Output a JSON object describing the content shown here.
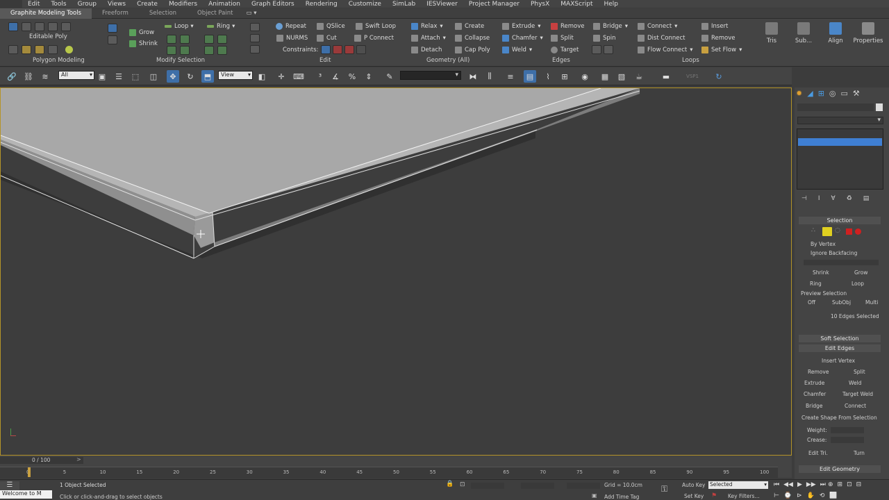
{
  "menu": [
    "Edit",
    "Tools",
    "Group",
    "Views",
    "Create",
    "Modifiers",
    "Animation",
    "Graph Editors",
    "Rendering",
    "Customize",
    "SimLab",
    "IESViewer",
    "Project Manager",
    "PhysX",
    "MAXScript",
    "Help"
  ],
  "ribbon_tabs": [
    "Graphite Modeling Tools",
    "Freeform",
    "Selection",
    "Object Paint"
  ],
  "ribbon": {
    "poly_label": "Editable Poly",
    "grow": "Grow",
    "shrink": "Shrink",
    "loop": "Loop",
    "ring": "Ring",
    "repeat": "Repeat",
    "qslice": "QSlice",
    "swift_loop": "Swift Loop",
    "nurms": "NURMS",
    "cut": "Cut",
    "p_connect": "P Connect",
    "constraints": "Constraints:",
    "relax": "Relax",
    "create": "Create",
    "attach": "Attach",
    "collapse": "Collapse",
    "detach": "Detach",
    "cap_poly": "Cap Poly",
    "extrude": "Extrude",
    "remove": "Remove",
    "bridge": "Bridge",
    "chamfer": "Chamfer",
    "split": "Split",
    "spin": "Spin",
    "weld": "Weld",
    "target": "Target",
    "connect": "Connect",
    "insert": "Insert",
    "dist_connect": "Dist Connect",
    "remove2": "Remove",
    "flow_connect": "Flow Connect",
    "set_flow": "Set Flow",
    "tris": "Tris",
    "sub": "Sub...",
    "align": "Align",
    "properties": "Properties",
    "panels": [
      "Polygon Modeling",
      "Modify Selection",
      "Edit",
      "Geometry (All)",
      "Edges",
      "Loops"
    ]
  },
  "toolbar": {
    "filter": "All",
    "view": "View"
  },
  "command_panel": {
    "selection_title": "Selection",
    "by_vertex": "By Vertex",
    "ignore_backfacing": "Ignore Backfacing",
    "shrink": "Shrink",
    "grow": "Grow",
    "ring": "Ring",
    "loop": "Loop",
    "preview_selection": "Preview Selection",
    "off": "Off",
    "subobj": "SubObj",
    "multi": "Multi",
    "edges_selected": "10 Edges Selected",
    "soft_selection": "Soft Selection",
    "edit_edges": "Edit Edges",
    "insert_vertex": "Insert Vertex",
    "remove": "Remove",
    "split": "Split",
    "extrude": "Extrude",
    "weld": "Weld",
    "chamfer": "Chamfer",
    "target_weld": "Target Weld",
    "bridge": "Bridge",
    "connect": "Connect",
    "create_shape": "Create Shape From Selection",
    "weight": "Weight:",
    "crease": "Crease:",
    "edit_tri": "Edit Tri.",
    "turn": "Turn",
    "edit_geometry": "Edit Geometry"
  },
  "timeline": {
    "frame": "0 / 100",
    "ticks": [
      "0",
      "5",
      "10",
      "15",
      "20",
      "25",
      "30",
      "35",
      "40",
      "45",
      "50",
      "55",
      "60",
      "65",
      "70",
      "75",
      "80",
      "85",
      "90",
      "95",
      "100"
    ]
  },
  "status": {
    "welcome": "Welcome to M",
    "selected": "1 Object Selected",
    "hint": "Click or click-and-drag to select objects",
    "grid": "Grid = 10.0cm",
    "add_time_tag": "Add Time Tag",
    "auto_key": "Auto Key",
    "set_key": "Set Key",
    "selected_dd": "Selected",
    "key_filters": "Key Filters..."
  }
}
